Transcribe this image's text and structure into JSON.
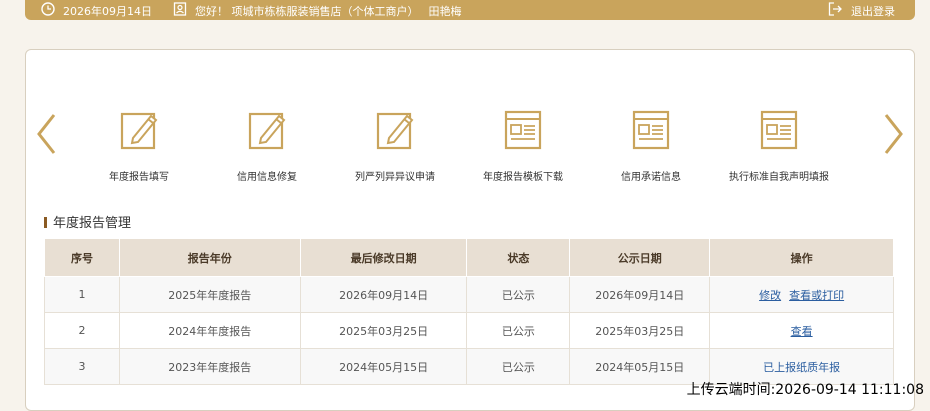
{
  "topbar": {
    "date": "2026年09月14日",
    "greeting": "您好！ 项城市栋栋服装销售店（个体工商户）",
    "user": "田艳梅",
    "logout": "退出登录"
  },
  "functions": [
    {
      "label": "年度报告填写",
      "icon": "edit-doc-icon"
    },
    {
      "label": "信用信息修复",
      "icon": "edit-doc-icon"
    },
    {
      "label": "列严列异异议申请",
      "icon": "edit-doc-icon"
    },
    {
      "label": "年度报告模板下载",
      "icon": "template-doc-icon"
    },
    {
      "label": "信用承诺信息",
      "icon": "template-doc-icon"
    },
    {
      "label": "执行标准自我声明填报",
      "icon": "template-doc-icon"
    }
  ],
  "section": {
    "title": "年度报告管理"
  },
  "table": {
    "headers": [
      "序号",
      "报告年份",
      "最后修改日期",
      "状态",
      "公示日期",
      "操作"
    ],
    "rows": [
      {
        "no": "1",
        "year": "2025年年度报告",
        "modified": "2026年09月14日",
        "status": "已公示",
        "published": "2026年09月14日",
        "actions": [
          "修改",
          "查看或打印"
        ]
      },
      {
        "no": "2",
        "year": "2024年年度报告",
        "modified": "2025年03月25日",
        "status": "已公示",
        "published": "2025年03月25日",
        "actions": [
          "查看"
        ]
      },
      {
        "no": "3",
        "year": "2023年年度报告",
        "modified": "2024年05月15日",
        "status": "已公示",
        "published": "2024年05月15日",
        "actions": [
          "已上报纸质年报"
        ]
      }
    ]
  },
  "watermark": "上传云端时间:2026-09-14 11:11:08",
  "colors": {
    "accent": "#c9a45c",
    "link": "#2b5ea0",
    "header_bg": "#e8dfd3"
  }
}
